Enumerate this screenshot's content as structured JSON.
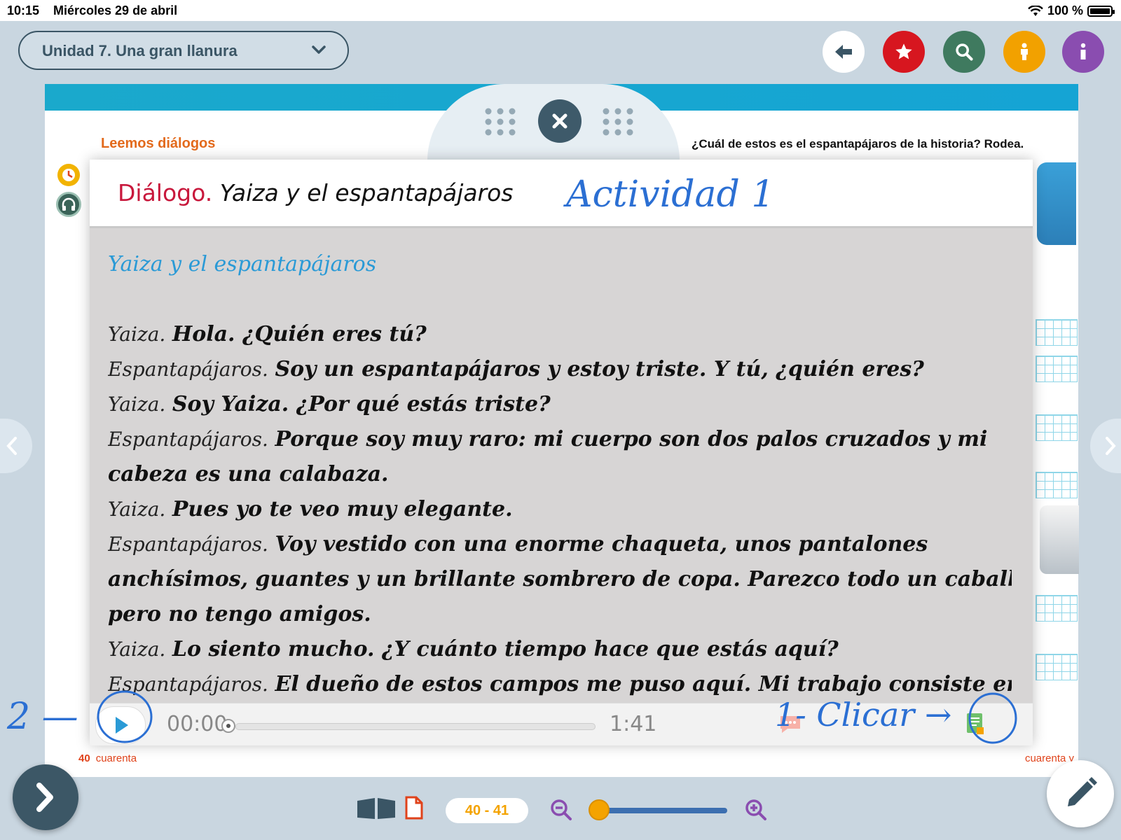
{
  "status_bar": {
    "time": "10:15",
    "date": "Miércoles 29 de abril",
    "battery": "100 %"
  },
  "unit_selector": {
    "label": "Unidad 7. Una gran llanura"
  },
  "toolbar": {
    "colors": {
      "back": "#ffffff",
      "favorite": "#d7161f",
      "search": "#3f7a5f",
      "accessibility": "#f2a100",
      "info": "#8a4db0"
    }
  },
  "book": {
    "left_title": "Leemos diálogos",
    "right_title": "¿Cuál de estos es el espantapájaros de la historia? Rodea.",
    "left_page_num": "40",
    "left_page_word": "cuarenta",
    "right_page_word": "cuarenta y"
  },
  "dialog": {
    "label": "Diálogo.",
    "title": "Yaiza y el espantapájaros",
    "annotation": "Actividad 1",
    "subtitle": "Yaiza y el espantapájaros",
    "lines": [
      {
        "speaker": "Yaiza.",
        "text": "Hola. ¿Quién eres tú?"
      },
      {
        "speaker": "Espantapájaros.",
        "text": "Soy un espantapájaros y estoy triste. Y tú, ¿quién eres?"
      },
      {
        "speaker": "Yaiza.",
        "text": "Soy Yaiza. ¿Por qué estás triste?"
      },
      {
        "speaker": "Espantapájaros.",
        "text": "Porque soy muy raro: mi cuerpo son dos palos cruzados y mi"
      },
      {
        "speaker": "",
        "text": "cabeza es una calabaza."
      },
      {
        "speaker": "Yaiza.",
        "text": "Pues yo te veo muy elegante."
      },
      {
        "speaker": "Espantapájaros.",
        "text": "Voy vestido con una enorme chaqueta, unos pantalones"
      },
      {
        "speaker": "",
        "text": "anchísimos, guantes y un brillante sombrero de copa. Parezco todo un caballero,"
      },
      {
        "speaker": "",
        "text": "pero no tengo amigos."
      },
      {
        "speaker": "Yaiza.",
        "text": "Lo siento mucho. ¿Y cuánto tiempo hace que estás aquí?"
      },
      {
        "speaker": "Espantapájaros.",
        "text": "El dueño de estos campos me puso aquí. Mi trabajo consiste en"
      }
    ]
  },
  "player": {
    "current": "00:00",
    "duration": "1:41",
    "progress": 0
  },
  "annotations": {
    "step_one": "1- Clicar →",
    "step_two": "2 —"
  },
  "bottom_bar": {
    "pages": "40 - 41",
    "zoom_level": 0
  }
}
